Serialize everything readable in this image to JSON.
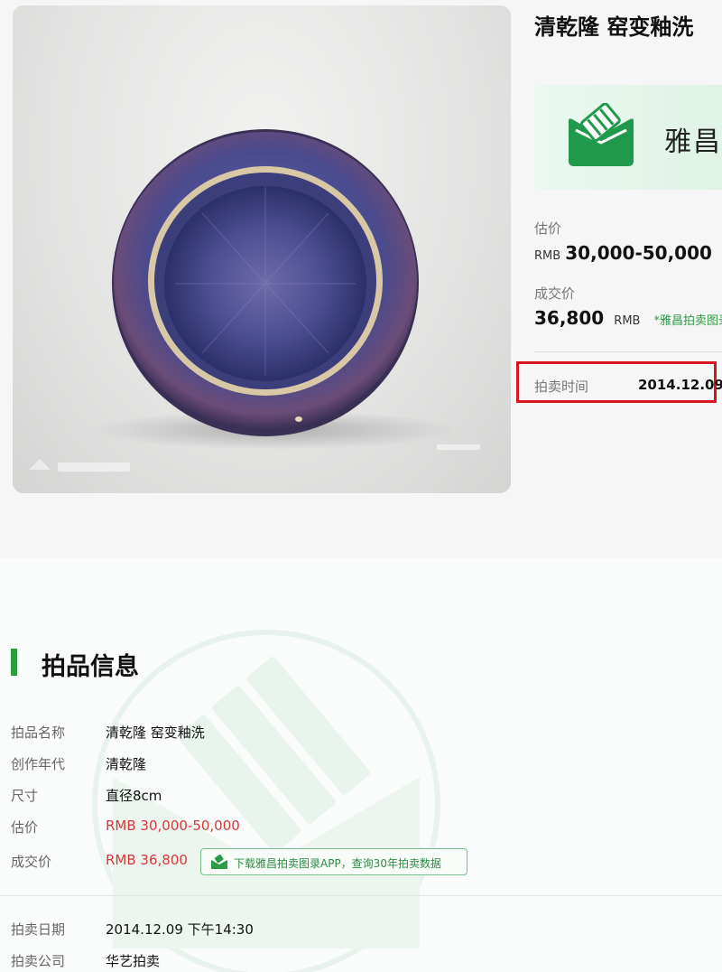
{
  "lot": {
    "title": "清乾隆 窑变釉洗",
    "banner_name": "雅昌拍",
    "estimate_label": "估价",
    "estimate_currency": "RMB",
    "estimate_value": "30,000-50,000",
    "deal_label": "成交价",
    "deal_value": "36,800",
    "deal_currency": "RMB",
    "deal_note": "*雅昌拍卖图录",
    "auction_time_label": "拍卖时间",
    "auction_time_value": "2014.12.09"
  },
  "info": {
    "section_title": "拍品信息",
    "rows": [
      {
        "key": "拍品名称",
        "value": "清乾隆 窑变釉洗"
      },
      {
        "key": "创作年代",
        "value": "清乾隆"
      },
      {
        "key": "尺寸",
        "value": "直径8cm"
      },
      {
        "key": "估价",
        "value": "RMB 30,000-50,000"
      },
      {
        "key": "成交价",
        "value": "RMB 36,800"
      },
      {
        "key": "拍卖日期",
        "value": "2014.12.09 下午14:30"
      },
      {
        "key": "拍卖公司",
        "value": "华艺拍卖"
      }
    ],
    "app_button_label": "下载雅昌拍卖图录APP，查询30年拍卖数据"
  },
  "icons": {
    "brand_logo": "artron-hammer-logo-icon",
    "app_icon": "artron-small-logo-icon"
  },
  "colors": {
    "brand_green": "#2f9a3e",
    "price_red": "#d23a3a",
    "highlight_red": "#d9151d"
  }
}
